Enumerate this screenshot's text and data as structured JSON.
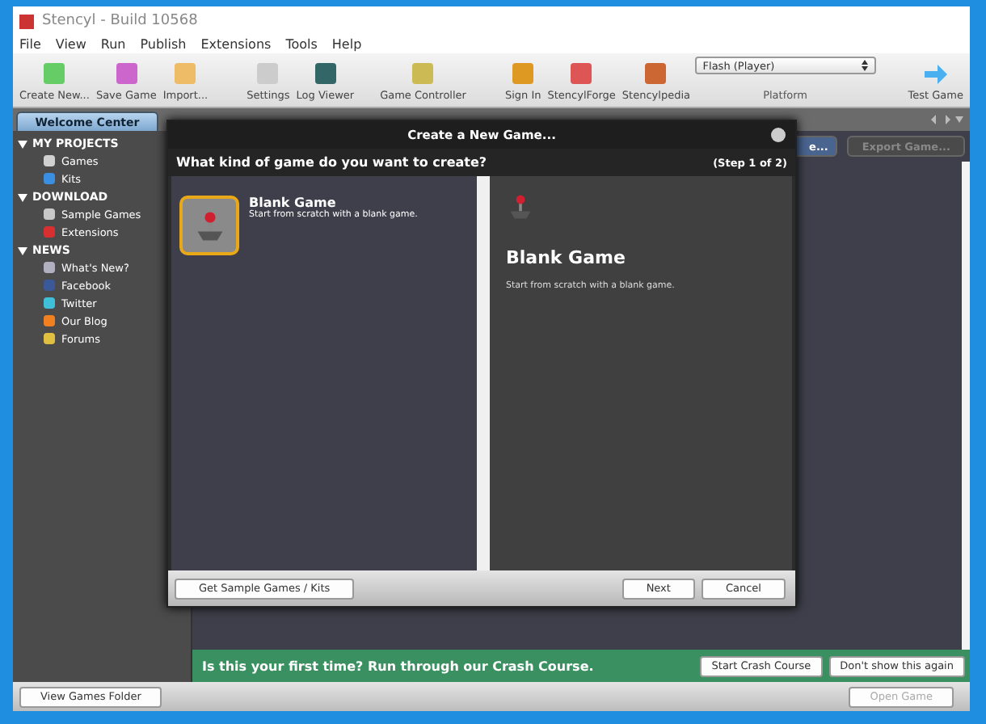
{
  "window": {
    "title": "Stencyl - Build 10568"
  },
  "menu": [
    "File",
    "View",
    "Run",
    "Publish",
    "Extensions",
    "Tools",
    "Help"
  ],
  "toolbar": [
    {
      "label": "Create New..."
    },
    {
      "label": "Save Game"
    },
    {
      "label": "Import..."
    },
    {
      "label": "Settings"
    },
    {
      "label": "Log Viewer"
    },
    {
      "label": "Game Controller"
    },
    {
      "label": "Sign In"
    },
    {
      "label": "StencylForge"
    },
    {
      "label": "Stencylpedia"
    }
  ],
  "platform": {
    "value": "Flash (Player)",
    "label": "Platform"
  },
  "test_game": "Test Game",
  "tabs": [
    {
      "label": "Welcome Center",
      "selected": true
    }
  ],
  "sidebar": [
    {
      "label": "MY PROJECTS",
      "expanded": true,
      "children": [
        {
          "label": "Games",
          "color": "#d0d0d0"
        },
        {
          "label": "Kits",
          "color": "#3a8fe0"
        }
      ]
    },
    {
      "label": "DOWNLOAD",
      "expanded": true,
      "children": [
        {
          "label": "Sample Games",
          "color": "#c8c8c8"
        },
        {
          "label": "Extensions",
          "color": "#d83030"
        }
      ]
    },
    {
      "label": "NEWS",
      "expanded": true,
      "children": [
        {
          "label": "What's New?",
          "color": "#b0b0c0"
        },
        {
          "label": "Facebook",
          "color": "#3b5998"
        },
        {
          "label": "Twitter",
          "color": "#40c0d8"
        },
        {
          "label": "Our Blog",
          "color": "#f08020"
        },
        {
          "label": "Forums",
          "color": "#e0c040"
        }
      ]
    }
  ],
  "content_buttons": [
    {
      "label": "e...",
      "disabled": false
    },
    {
      "label": "Export Game...",
      "disabled": true
    }
  ],
  "dialog": {
    "title": "Create a New Game...",
    "question": "What kind of game do you want to create?",
    "step": "(Step 1 of 2)",
    "items": [
      {
        "title": "Blank Game",
        "description": "Start from scratch with a blank game.",
        "selected": true
      }
    ],
    "detail": {
      "title": "Blank Game",
      "description": "Start from scratch with a blank game."
    },
    "footer_left": "Get Sample Games / Kits",
    "buttons": [
      "Next",
      "Cancel"
    ]
  },
  "banner": {
    "text": "Is this your first time? Run through our Crash Course.",
    "buttons": [
      "Start Crash Course",
      "Don't show this again"
    ]
  },
  "bottom": {
    "left": "View Games Folder",
    "right": {
      "label": "Open Game",
      "disabled": true
    }
  }
}
